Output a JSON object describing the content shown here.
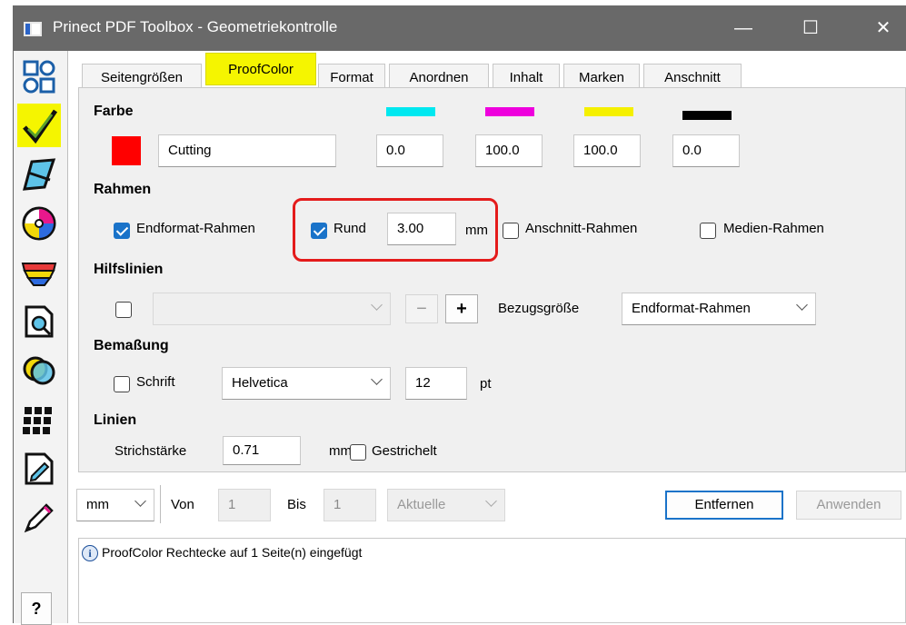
{
  "window": {
    "title": "Prinect PDF Toolbox - Geometriekontrolle",
    "minimize_glyph": "—",
    "maximize_glyph": "☐",
    "close_glyph": "✕"
  },
  "tabs": [
    "Seitengrößen",
    "ProofColor",
    "Format",
    "Anordnen",
    "Inhalt",
    "Marken",
    "Anschnitt"
  ],
  "active_tab": "ProofColor",
  "farbe": {
    "heading": "Farbe",
    "swatch_color": "#ff0000",
    "name_value": "Cutting",
    "channels": [
      {
        "name": "cyan-icon",
        "color": "#00e8f0",
        "value": "0.0"
      },
      {
        "name": "magenta-icon",
        "color": "#ee00dd",
        "value": "100.0"
      },
      {
        "name": "yellow-icon",
        "color": "#f5f000",
        "value": "100.0"
      },
      {
        "name": "black-icon",
        "color": "#000000",
        "value": "0.0"
      }
    ]
  },
  "rahmen": {
    "heading": "Rahmen",
    "endformat_label": "Endformat-Rahmen",
    "endformat_checked": true,
    "rund_label": "Rund",
    "rund_checked": true,
    "rund_value": "3.00",
    "rund_unit": "mm",
    "anschnitt_label": "Anschnitt-Rahmen",
    "anschnitt_checked": false,
    "medien_label": "Medien-Rahmen",
    "medien_checked": false
  },
  "hilfslinien": {
    "heading": "Hilfslinien",
    "checked": false,
    "select_value": "",
    "minus_glyph": "−",
    "plus_glyph": "+",
    "bezug_label": "Bezugsgröße",
    "bezug_value": "Endformat-Rahmen"
  },
  "bemassung": {
    "heading": "Bemaßung",
    "schrift_label": "Schrift",
    "schrift_checked": false,
    "font_value": "Helvetica",
    "size_value": "12",
    "size_unit": "pt"
  },
  "linien": {
    "heading": "Linien",
    "strich_label": "Strichstärke",
    "strich_value": "0.71",
    "strich_unit": "mm",
    "gestrichelt_label": "Gestrichelt",
    "gestrichelt_checked": false
  },
  "bottom": {
    "unit_value": "mm",
    "von_label": "Von",
    "von_value": "1",
    "bis_label": "Bis",
    "bis_value": "1",
    "aktuelle_value": "Aktuelle",
    "entfernen_label": "Entfernen",
    "anwenden_label": "Anwenden"
  },
  "message": {
    "info_glyph": "i",
    "text": "ProofColor Rechtecke auf 1 Seite(n) eingefügt"
  },
  "help_glyph": "?",
  "sidebar": [
    "toolbox-icon",
    "geometry-check-icon",
    "transform-icon",
    "color-disc-icon",
    "swatch-fan-icon",
    "preflight-icon",
    "overlap-circles-icon",
    "grid-icon",
    "edit-page-icon",
    "pen-tool-icon"
  ]
}
